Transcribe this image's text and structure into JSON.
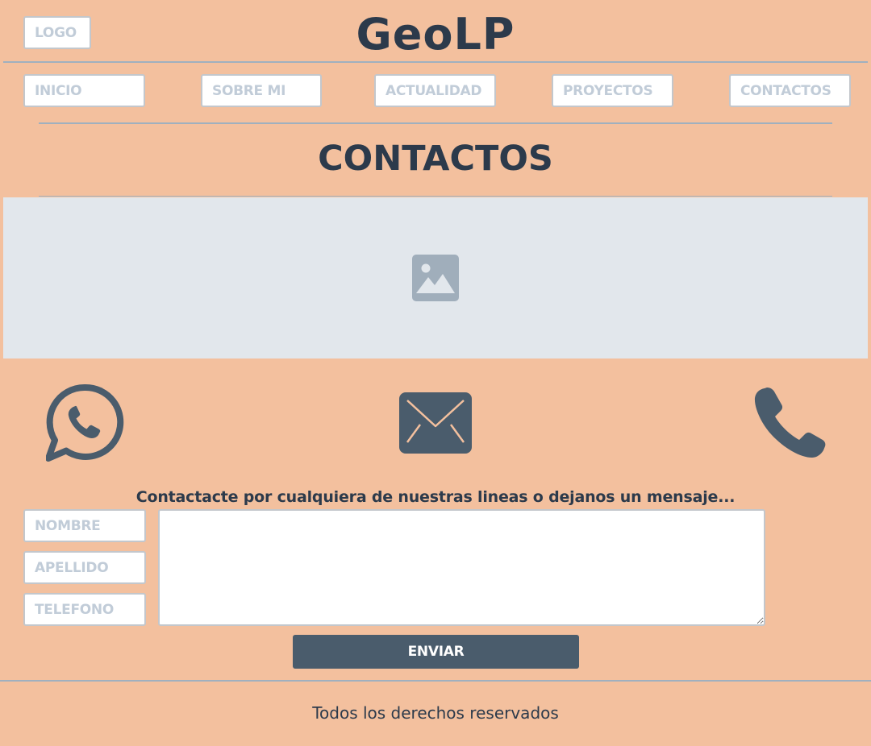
{
  "header": {
    "logo_label": "LOGO",
    "site_title": "GeoLP"
  },
  "nav": {
    "items": [
      {
        "label": "INICIO"
      },
      {
        "label": "SOBRE MI"
      },
      {
        "label": "ACTUALIDAD"
      },
      {
        "label": "PROYECTOS"
      },
      {
        "label": "CONTACTOS"
      }
    ]
  },
  "main": {
    "section_title": "CONTACTOS",
    "image_placeholder_icon": "image-icon",
    "contact_icons": [
      "whatsapp-icon",
      "mail-icon",
      "phone-icon"
    ],
    "tagline": "Contactacte por cualquiera de nuestras lineas o dejanos un mensaje...",
    "form": {
      "nombre_placeholder": "NOMBRE",
      "apellido_placeholder": "APELLIDO",
      "telefono_placeholder": "TELEFONO",
      "message_value": "",
      "submit_label": "ENVIAR"
    }
  },
  "footer": {
    "text": "Todos los derechos reservados"
  },
  "colors": {
    "background": "#f3c09e",
    "heading_text": "#2c3a4b",
    "icon_dark": "#4a5c6c",
    "divider": "#9fb0bf",
    "placeholder_bg": "#e2e7ec",
    "placeholder_icon": "#a0aebb",
    "button_bg": "#4a5c6c"
  }
}
